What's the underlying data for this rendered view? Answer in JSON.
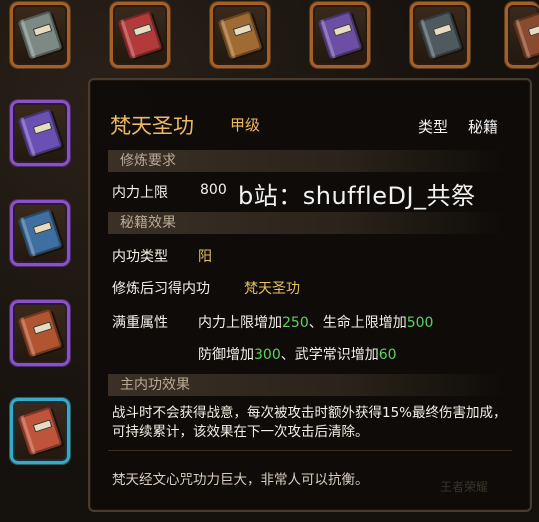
{
  "tooltip": {
    "title": "梵天圣功",
    "grade": "甲级",
    "type_label": "类型",
    "type_value": "秘籍",
    "sections": {
      "requirements": "修炼要求",
      "effects": "秘籍效果",
      "main_effect": "主内功效果"
    },
    "req_label": "内力上限",
    "req_value": "800",
    "watermark": "b站：shuffleDJ_共祭",
    "neigong_type_label": "内功类型",
    "neigong_type_value": "阳",
    "learn_label": "修炼后习得内功",
    "learn_value": "梵天圣功",
    "max_label": "满重属性",
    "max_line1_a": "内力上限增加",
    "max_line1_b": "250",
    "max_line1_c": "、生命上限增加",
    "max_line1_d": "500",
    "max_line2_a": "防御增加",
    "max_line2_b": "300",
    "max_line2_c": "、武学常识增加",
    "max_line2_d": "60",
    "main_desc": "战斗时不会获得战意，每次被攻击时额外获得15%最终伤害加成，可持续累计，该效果在下一次攻击后清除。",
    "flavor": "梵天经文心咒功力巨大，非常人可以抗衡。",
    "corner_logo": "王者荣耀"
  },
  "inventory": {
    "slots": [
      {
        "rarity": "orange",
        "book_color": "#7d8a84",
        "icon": "book-icon"
      },
      {
        "rarity": "orange",
        "book_color": "#b33a3a",
        "icon": "book-icon"
      },
      {
        "rarity": "orange",
        "book_color": "#a06b32",
        "icon": "book-icon"
      },
      {
        "rarity": "orange",
        "book_color": "#6c4fa5",
        "icon": "book-icon"
      },
      {
        "rarity": "orange",
        "book_color": "#4f5a5f",
        "icon": "book-icon"
      },
      {
        "rarity": "orange",
        "book_color": "#8a4a2f",
        "icon": "book-icon"
      },
      {
        "rarity": "purple",
        "book_color": "#6a4fb5",
        "icon": "book-icon"
      },
      {
        "rarity": "purple",
        "book_color": "#3f6ea0",
        "icon": "book-icon"
      },
      {
        "rarity": "purple",
        "book_color": "#b0552f",
        "icon": "book-icon"
      },
      {
        "rarity": "cyan",
        "book_color": "#c0543b",
        "icon": "book-icon"
      }
    ]
  },
  "colors": {
    "title_gold": "#f0b860",
    "value_gold": "#e6c35a",
    "value_green": "#5fd25a",
    "panel_bg": "#0e0b08"
  }
}
